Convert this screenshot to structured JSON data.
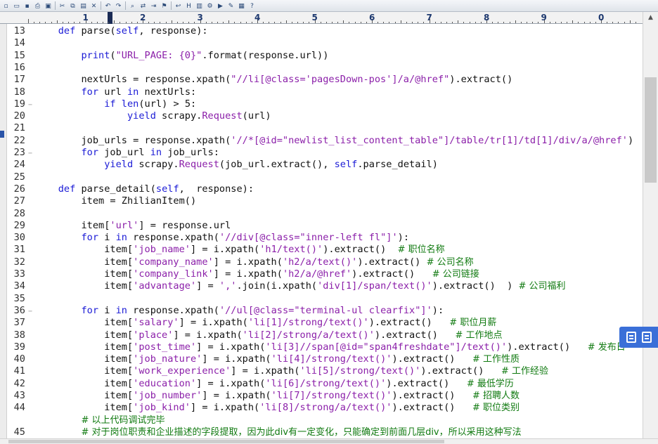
{
  "toolbar": {
    "icons": [
      "new-file-icon",
      "open-file-icon",
      "save-icon",
      "print-icon",
      "print-preview-icon",
      "cut-icon",
      "copy-icon",
      "paste-icon",
      "delete-icon",
      "undo-icon",
      "redo-icon",
      "find-icon",
      "find-replace-icon",
      "goto-icon",
      "bookmark-icon",
      "word-wrap-icon",
      "hex-icon",
      "column-mode-icon",
      "settings-icon",
      "macro-icon",
      "tools-icon",
      "window-icon",
      "help-icon"
    ]
  },
  "ruler": {
    "labels": [
      "1",
      "2",
      "3",
      "4",
      "5",
      "6",
      "7",
      "8",
      "9",
      "0"
    ]
  },
  "lines": [
    {
      "n": "13",
      "html": "    <span class=\"kw\">def</span> parse(<span class=\"kw\">self</span>, response):"
    },
    {
      "n": "14",
      "html": ""
    },
    {
      "n": "15",
      "html": "        <span class=\"bi\">print</span>(<span class=\"st\">\"URL_PAGE: {0}\"</span>.format(response.url))"
    },
    {
      "n": "16",
      "html": ""
    },
    {
      "n": "17",
      "html": "        nextUrls = response.xpath(<span class=\"st\">\"//li[@class='pagesDown-pos']/a/@href\"</span>).extract()"
    },
    {
      "n": "18",
      "html": "        <span class=\"kw\">for</span> url <span class=\"kw\">in</span> nextUrls:"
    },
    {
      "n": "19",
      "fold": "−",
      "html": "            <span class=\"kw\">if</span> <span class=\"bi\">len</span>(url) > 5:"
    },
    {
      "n": "20",
      "html": "                <span class=\"kw\">yield</span> scrapy.<span class=\"st\">Request</span>(url)"
    },
    {
      "n": "21",
      "html": ""
    },
    {
      "n": "22",
      "html": "        job_urls = response.xpath(<span class=\"st\">'//*[@id=\"newlist_list_content_table\"]/table/tr[1]/td[1]/div/a/@href'</span>)"
    },
    {
      "n": "23",
      "fold": "−",
      "html": "        <span class=\"kw\">for</span> job_url <span class=\"kw\">in</span> job_urls:"
    },
    {
      "n": "24",
      "html": "            <span class=\"kw\">yield</span> scrapy.<span class=\"st\">Request</span>(job_url.extract(), <span class=\"kw\">self</span>.parse_detail)"
    },
    {
      "n": "25",
      "html": ""
    },
    {
      "n": "26",
      "html": "    <span class=\"kw\">def</span> parse_detail(<span class=\"kw\">self</span>,  response):"
    },
    {
      "n": "27",
      "cur": true,
      "html": "        item = ZhilianItem()"
    },
    {
      "n": "28",
      "html": ""
    },
    {
      "n": "29",
      "html": "        item[<span class=\"st\">'url'</span>] = response.url"
    },
    {
      "n": "30",
      "html": "        <span class=\"kw\">for</span> i <span class=\"kw\">in</span> response.xpath(<span class=\"st\">'//div[@class=\"inner-left fl\"]'</span>):"
    },
    {
      "n": "31",
      "html": "            item[<span class=\"st\">'job_name'</span>] = i.xpath(<span class=\"st\">'h1/text()'</span>).extract()  <span class=\"cm\"># 职位名称</span>"
    },
    {
      "n": "32",
      "html": "            item[<span class=\"st\">'company_name'</span>] = i.xpath(<span class=\"st\">'h2/a/text()'</span>).extract() <span class=\"cm\"># 公司名称</span>"
    },
    {
      "n": "33",
      "html": "            item[<span class=\"st\">'company_link'</span>] = i.xpath(<span class=\"st\">'h2/a/@href'</span>).extract()   <span class=\"cm\"># 公司链接</span>"
    },
    {
      "n": "34",
      "html": "            item[<span class=\"st\">'advantage'</span>] = <span class=\"st\">','</span>.join(i.xpath(<span class=\"st\">'div[1]/span/text()'</span>).extract()  ) <span class=\"cm\"># 公司福利</span>"
    },
    {
      "n": "35",
      "html": ""
    },
    {
      "n": "36",
      "fold": "−",
      "html": "        <span class=\"kw\">for</span> i <span class=\"kw\">in</span> response.xpath(<span class=\"st\">'//ul[@class=\"terminal-ul clearfix\"]'</span>):"
    },
    {
      "n": "37",
      "html": "            item[<span class=\"st\">'salary'</span>] = i.xpath(<span class=\"st\">'li[1]/strong/text()'</span>).extract()   <span class=\"cm\"># 职位月薪</span>"
    },
    {
      "n": "38",
      "html": "            item[<span class=\"st\">'place'</span>] = i.xpath(<span class=\"st\">'li[2]/strong/a/text()'</span>).extract()   <span class=\"cm\"># 工作地点</span>"
    },
    {
      "n": "39",
      "html": "            item[<span class=\"st\">'post_time'</span>] = i.xpath(<span class=\"st\">'li[3]//span[@id=\"span4freshdate\"]/text()'</span>).extract()   <span class=\"cm\"># 发布日</span>"
    },
    {
      "n": "40",
      "html": "            item[<span class=\"st\">'job_nature'</span>] = i.xpath(<span class=\"st\">'li[4]/strong/text()'</span>).extract()   <span class=\"cm\"># 工作性质</span>"
    },
    {
      "n": "41",
      "html": "            item[<span class=\"st\">'work_experience'</span>] = i.xpath(<span class=\"st\">'li[5]/strong/text()'</span>).extract()   <span class=\"cm\"># 工作经验</span>"
    },
    {
      "n": "42",
      "html": "            item[<span class=\"st\">'education'</span>] = i.xpath(<span class=\"st\">'li[6]/strong/text()'</span>).extract()   <span class=\"cm\"># 最低学历</span>"
    },
    {
      "n": "43",
      "html": "            item[<span class=\"st\">'job_number'</span>] = i.xpath(<span class=\"st\">'li[7]/strong/text()'</span>).extract()   <span class=\"cm\"># 招聘人数</span>"
    },
    {
      "n": "44",
      "html": "            item[<span class=\"st\">'job_kind'</span>] = i.xpath(<span class=\"st\">'li[8]/strong/a/text()'</span>).extract()   <span class=\"cm\"># 职位类别</span>"
    },
    {
      "n": "",
      "html": "        <span class=\"cm\"># 以上代码调试完毕</span>"
    },
    {
      "n": "45",
      "html": "        <span class=\"cm\"># 对于岗位职责和企业描述的字段提取，因为此div有一定变化，只能确定到前面几层div，所以采用这种写法</span>"
    }
  ],
  "colors": {
    "keyword": "#1b1bd6",
    "string": "#8b1fa9",
    "comment": "#107a10",
    "accent": "#3a6fd8"
  },
  "float_panel": {
    "icons": [
      "notes-icon",
      "clipboard-icon"
    ]
  }
}
